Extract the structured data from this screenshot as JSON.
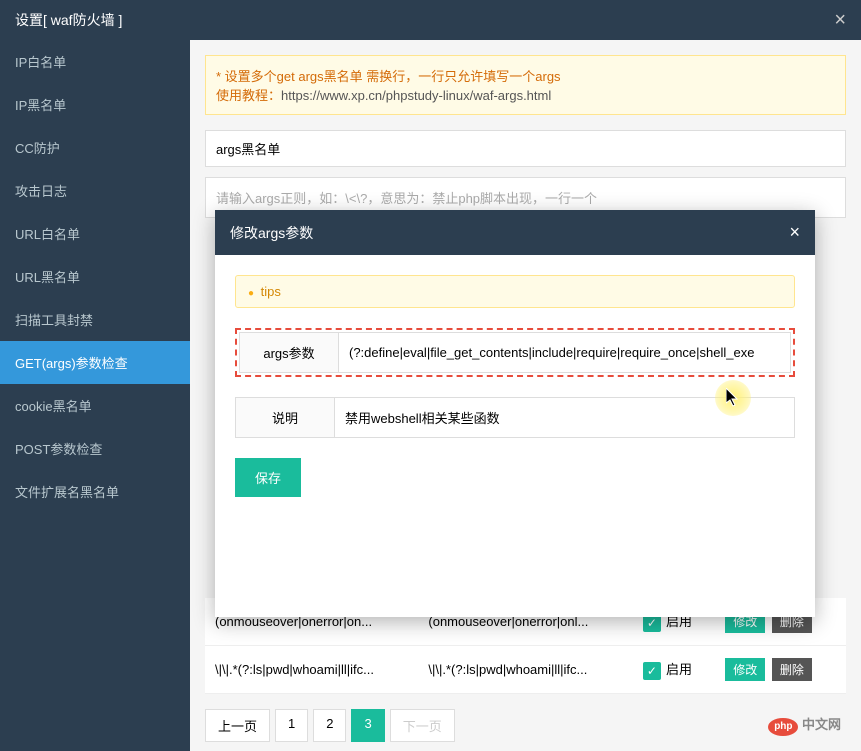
{
  "header": {
    "title": "设置[ waf防火墙 ]",
    "close": "×"
  },
  "sidebar": {
    "items": [
      {
        "label": "IP白名单"
      },
      {
        "label": "IP黑名单"
      },
      {
        "label": "CC防护"
      },
      {
        "label": "攻击日志"
      },
      {
        "label": "URL白名单"
      },
      {
        "label": "URL黑名单"
      },
      {
        "label": "扫描工具封禁"
      },
      {
        "label": "GET(args)参数检查"
      },
      {
        "label": "cookie黑名单"
      },
      {
        "label": "POST参数检查"
      },
      {
        "label": "文件扩展名黑名单"
      }
    ],
    "active_index": 7
  },
  "warning": {
    "line2": "* 设置多个get args黑名单 需换行，一行只允许填写一个args",
    "line3_label": "使用教程：",
    "line3_url": "https://www.xp.cn/phpstudy-linux/waf-args.html"
  },
  "inputs": {
    "name_value": "args黑名单",
    "regex_placeholder": "请输入args正则，如：\\<\\?，意思为：禁止php脚本出现，一行一个"
  },
  "table": {
    "rows": [
      {
        "col1": "(onmouseover|onerror|on...",
        "col2": "(onmouseover|onerror|onl...",
        "status": "启用"
      },
      {
        "col1": "\\|\\|.*(?:ls|pwd|whoami|ll|ifc...",
        "col2": "\\|\\|.*(?:ls|pwd|whoami|ll|ifc...",
        "status": "启用"
      }
    ],
    "btn_edit": "修改",
    "btn_delete": "删除"
  },
  "pagination": {
    "prev": "上一页",
    "next": "下一页",
    "pages": [
      "1",
      "2",
      "3"
    ],
    "current": 3
  },
  "modal": {
    "title": "修改args参数",
    "close": "×",
    "tips": "tips",
    "form": {
      "label1": "args参数",
      "value1": "(?:define|eval|file_get_contents|include|require|require_once|shell_exe",
      "label2": "说明",
      "value2": "禁用webshell相关某些函数",
      "save": "保存"
    }
  },
  "footer": {
    "logo_php": "php",
    "logo_cn": "中文网"
  }
}
